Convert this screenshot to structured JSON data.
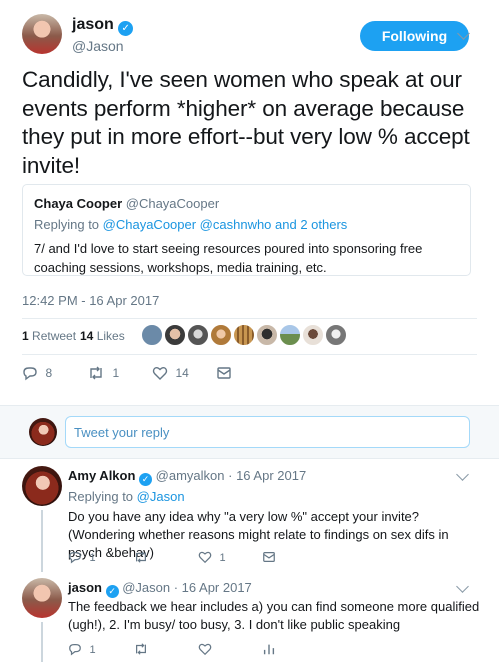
{
  "tweet": {
    "author_name": "jason",
    "author_handle": "@Jason",
    "follow_label": "Following",
    "text": "Candidly, I've seen women who speak at our events perform *higher* on average because they put in more effort--but very low % accept invite!",
    "timestamp": "12:42 PM - 16 Apr 2017",
    "retweet_count": "1",
    "retweet_label": "Retweet",
    "like_count": "14",
    "like_label": "Likes",
    "actions": {
      "replies": "8",
      "retweets": "1",
      "likes": "14"
    }
  },
  "quoted": {
    "name": "Chaya Cooper",
    "handle": "@ChayaCooper",
    "replying_prefix": "Replying to ",
    "replying_to": "@ChayaCooper @cashnwho and 2 others",
    "text": "7/ and I'd love to start seeing resources poured into sponsoring free coaching sessions, workshops, media training, etc."
  },
  "reply_box": {
    "placeholder": "Tweet your reply"
  },
  "replies": [
    {
      "name": "Amy Alkon",
      "handle": "@amyalkon",
      "date": "· 16 Apr 2017",
      "replying_prefix": "Replying to ",
      "replying_to": "@Jason",
      "text": "Do you have any idea why \"a very low %\" accept your invite? (Wondering whether reasons might relate to findings on sex difs in psych &behav)",
      "replies": "1",
      "retweets": "",
      "likes": "1"
    },
    {
      "name": "jason",
      "handle": "@Jason",
      "date": "· 16 Apr 2017",
      "text": "The feedback we hear includes a) you can find someone more qualified (ugh!), 2. I'm busy/ too busy, 3. I don't like public speaking",
      "replies": "1"
    }
  ],
  "colors": {
    "accent": "#1da1f2",
    "link": "#1b95e0",
    "muted": "#657786"
  },
  "icons": [
    "verified-icon",
    "chevron-down-icon",
    "reply-icon",
    "retweet-icon",
    "like-icon",
    "message-icon",
    "stats-icon"
  ]
}
